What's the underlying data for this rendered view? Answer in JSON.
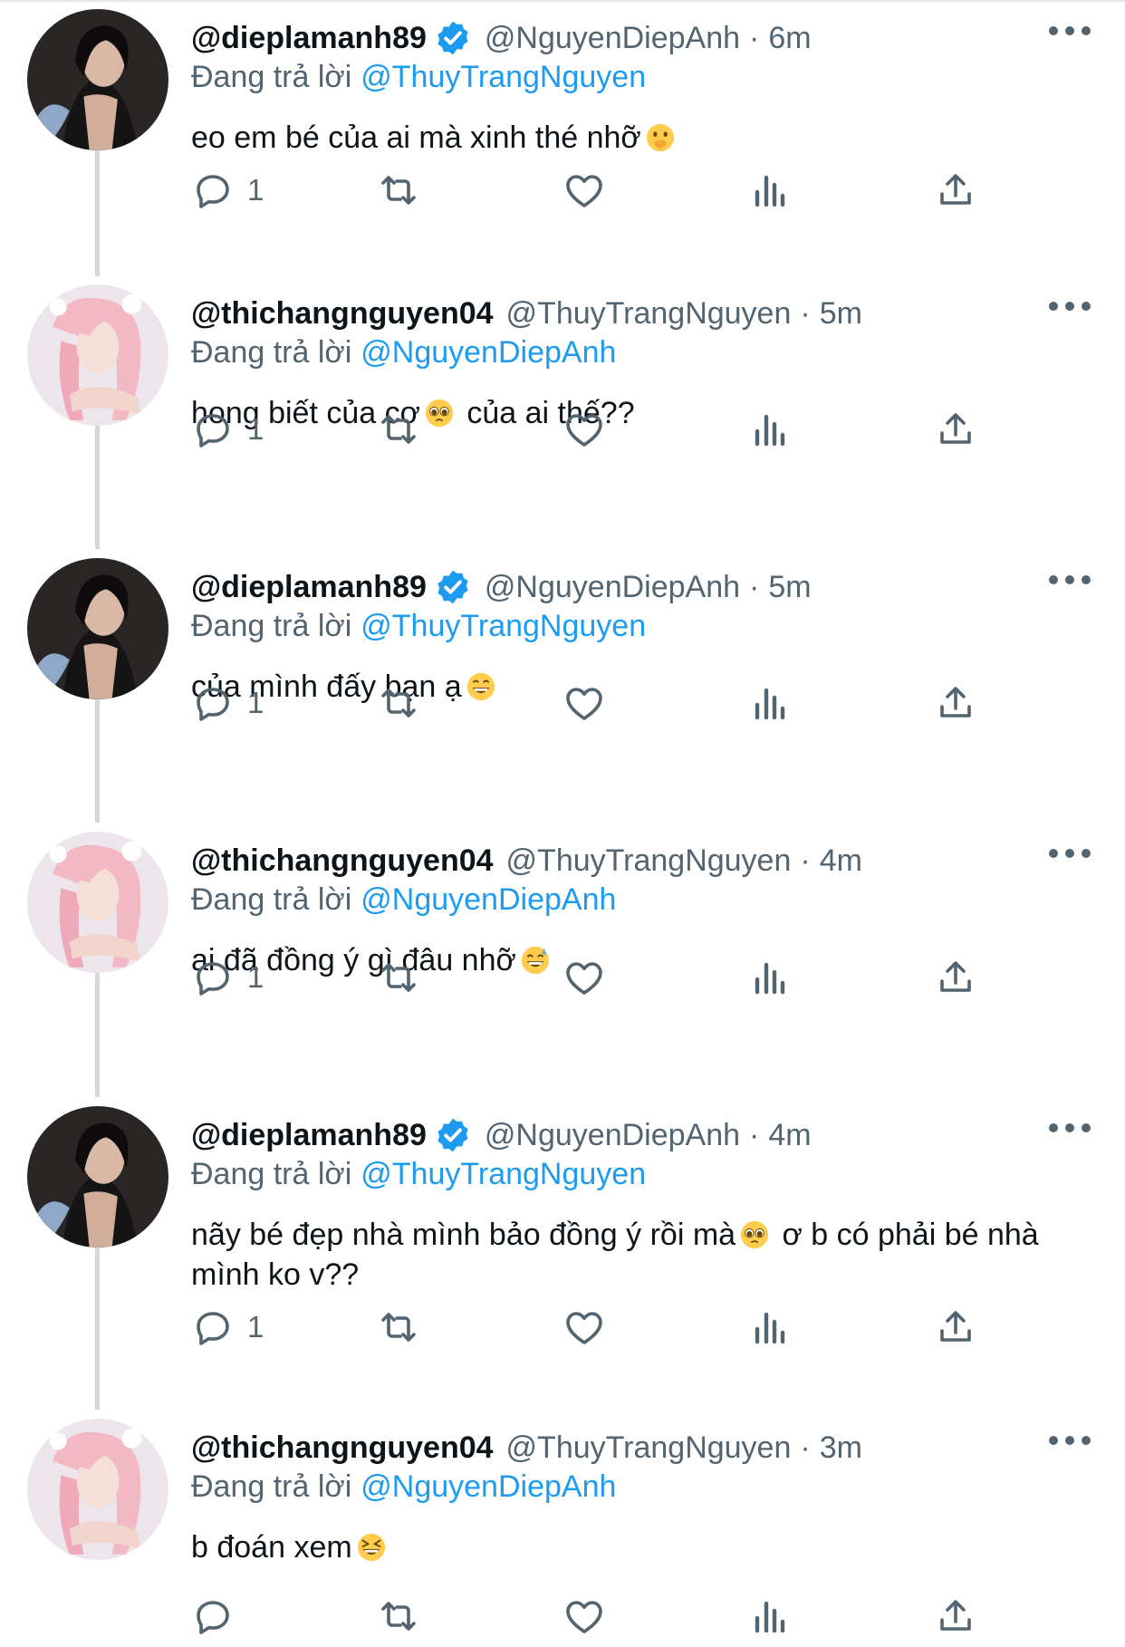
{
  "reply_prefix": "Đang trả lời",
  "colors": {
    "accent": "#1d9bf0",
    "secondary_text": "#536471",
    "thread_line": "#cfd9de"
  },
  "tweets": [
    {
      "display_name": "@dieplamanh89",
      "verified": true,
      "handle": "@NguyenDiepAnh",
      "time": "6m",
      "replying_to": "@ThuyTrangNguyen",
      "text_parts": [
        "eo em bé của ai mà xinh thé nhỡ",
        ""
      ],
      "emoji": "hand-over-mouth-emoji",
      "reply_count": "1"
    },
    {
      "display_name": "@thichangnguyen04",
      "verified": false,
      "handle": "@ThuyTrangNguyen",
      "time": "5m",
      "replying_to": "@NguyenDiepAnh",
      "text_parts": [
        "hong biết của cơ",
        " của ai thế??"
      ],
      "emoji": "pleading-face-emoji",
      "reply_count": "1"
    },
    {
      "display_name": "@dieplamanh89",
      "verified": true,
      "handle": "@NguyenDiepAnh",
      "time": "5m",
      "replying_to": "@ThuyTrangNguyen",
      "text_parts": [
        "của mình đấy bạn ạ",
        ""
      ],
      "emoji": "grinning-face-emoji",
      "reply_count": "1"
    },
    {
      "display_name": "@thichangnguyen04",
      "verified": false,
      "handle": "@ThuyTrangNguyen",
      "time": "4m",
      "replying_to": "@NguyenDiepAnh",
      "text_parts": [
        "ai đã đồng ý gì đâu nhỡ",
        ""
      ],
      "emoji": "grinning-sweat-emoji",
      "reply_count": "1"
    },
    {
      "display_name": "@dieplamanh89",
      "verified": true,
      "handle": "@NguyenDiepAnh",
      "time": "4m",
      "replying_to": "@ThuyTrangNguyen",
      "text_parts": [
        "nãy bé đẹp nhà mình bảo đồng ý rồi mà",
        " ơ b có phải bé nhà mình ko v??"
      ],
      "emoji": "pleading-face-emoji",
      "reply_count": "1"
    },
    {
      "display_name": "@thichangnguyen04",
      "verified": false,
      "handle": "@ThuyTrangNguyen",
      "time": "3m",
      "replying_to": "@NguyenDiepAnh",
      "text_parts": [
        "b đoán xem",
        ""
      ],
      "emoji": "laughing-squint-emoji",
      "reply_count": ""
    }
  ]
}
